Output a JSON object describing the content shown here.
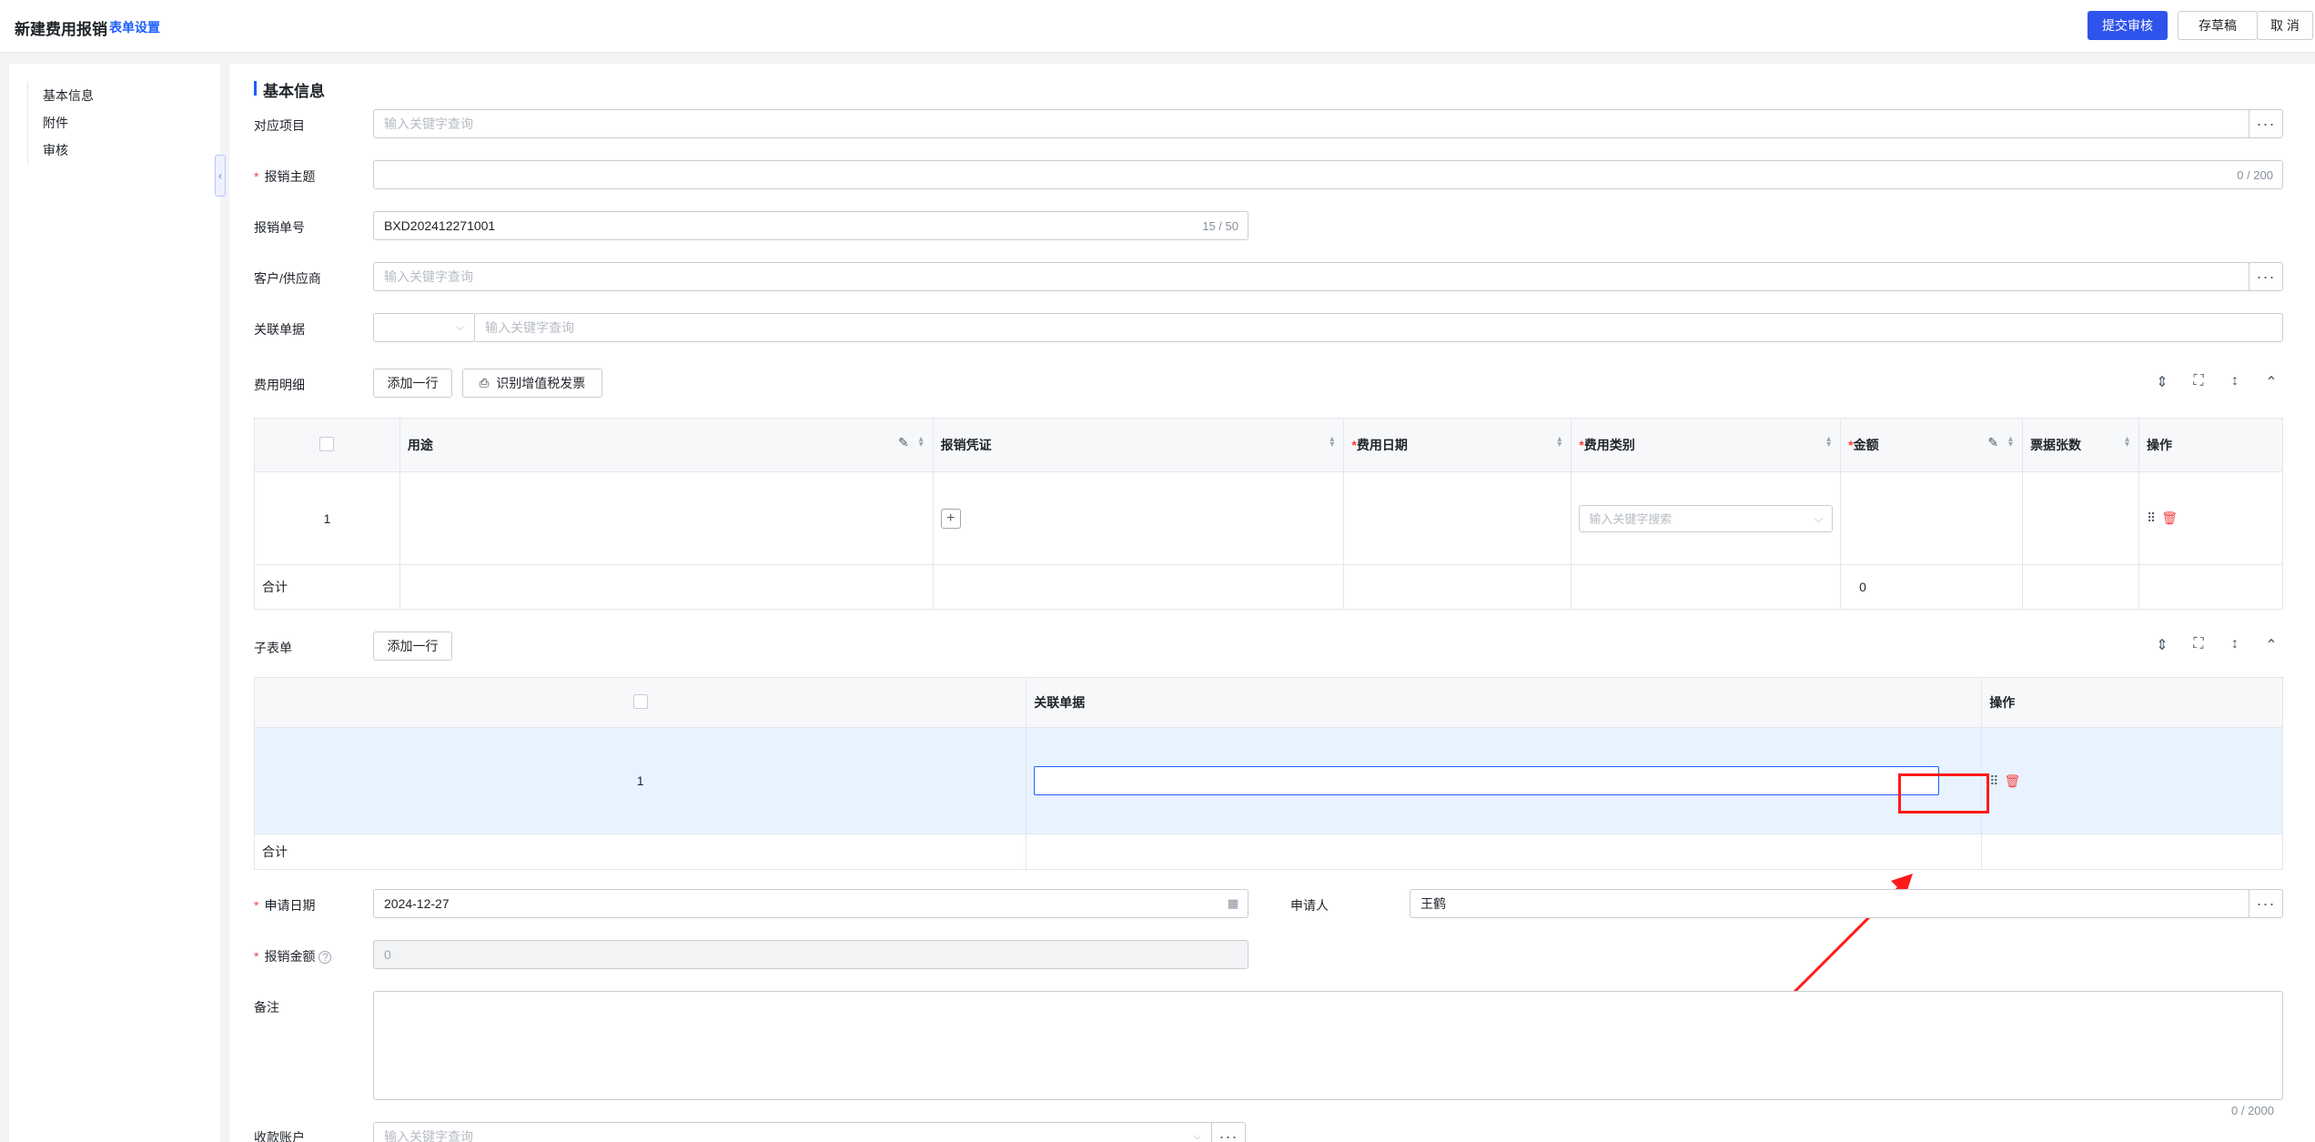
{
  "header": {
    "title": "新建费用报销",
    "settings_link": "表单设置",
    "submit_label": "提交审核",
    "draft_label": "存草稿",
    "cancel_label": "取 消"
  },
  "sidebar": {
    "items": [
      {
        "label": "基本信息"
      },
      {
        "label": "附件"
      },
      {
        "label": "审核"
      }
    ]
  },
  "section": {
    "title": "基本信息"
  },
  "form": {
    "project": {
      "label": "对应项目",
      "placeholder": "输入关键字查询"
    },
    "subject": {
      "label": "报销主题",
      "value": "",
      "counter": "0 / 200"
    },
    "order_no": {
      "label": "报销单号",
      "value": "BXD202412271001",
      "counter": "15 / 50"
    },
    "customer": {
      "label": "客户/供应商",
      "placeholder": "输入关键字查询"
    },
    "related": {
      "label": "关联单据",
      "placeholder": "输入关键字查询"
    },
    "apply_date": {
      "label": "申请日期",
      "value": "2024-12-27"
    },
    "applicant": {
      "label": "申请人",
      "value": "王鹤"
    },
    "amount": {
      "label": "报销金额",
      "value": "0"
    },
    "remark": {
      "label": "备注",
      "counter": "0 / 2000"
    },
    "account": {
      "label": "收款账户",
      "placeholder": "输入关键字查询"
    }
  },
  "expense": {
    "label": "费用明细",
    "add_row": "添加一行",
    "vat_btn": "识别增值税发票",
    "columns": [
      "用途",
      "报销凭证",
      "费用日期",
      "费用类别",
      "金额",
      "票据张数",
      "操作"
    ],
    "row_index": "1",
    "category_placeholder": "输入关键字搜索",
    "total_label": "合计",
    "total_amount": "0"
  },
  "subform": {
    "label": "子表单",
    "add_row": "添加一行",
    "columns": [
      "关联单据",
      "操作"
    ],
    "row_index": "1",
    "total_label": "合计"
  },
  "colors": {
    "primary": "#2f54eb",
    "link": "#1e5eff",
    "danger": "#f53f3f",
    "annotation": "#ff1a1a"
  },
  "icons": [
    "chevron-left-icon",
    "ellipsis-icon",
    "chevron-down-icon",
    "invoice-scan-icon",
    "row-height-icon",
    "fullscreen-icon",
    "expand-vertical-icon",
    "chevron-up-icon",
    "edit-icon",
    "sort-icon",
    "plus-icon",
    "drag-handle-icon",
    "trash-icon",
    "calendar-icon",
    "help-circle-icon",
    "annotation-arrow"
  ]
}
